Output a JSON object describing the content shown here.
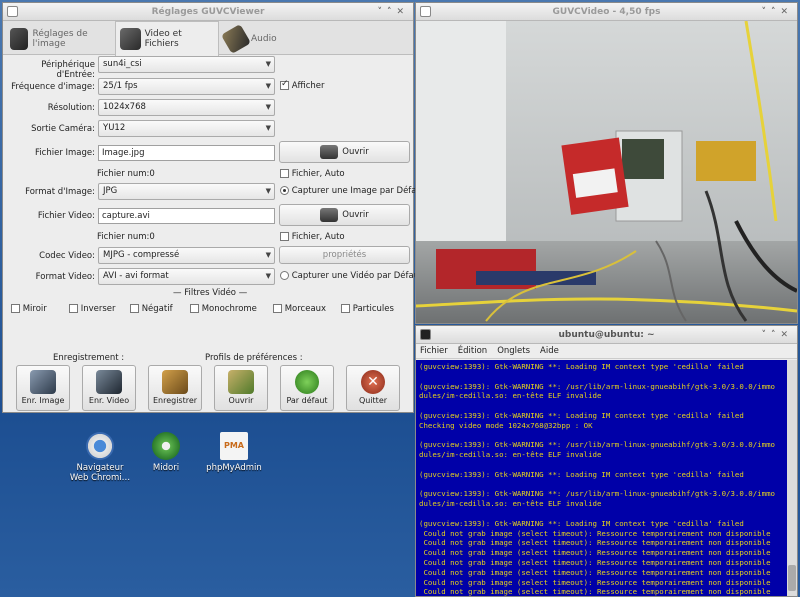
{
  "settings": {
    "title": "Réglages GUVCViewer",
    "tabs": [
      "Réglages de l'image",
      "Video et Fichiers",
      "Audio"
    ],
    "peripherique": {
      "label": "Périphérique d'Entrée:",
      "value": "sun4i_csi"
    },
    "frequence": {
      "label": "Fréquence d'image:",
      "value": "25/1 fps",
      "afficher": "Afficher"
    },
    "resolution": {
      "label": "Résolution:",
      "value": "1024x768"
    },
    "sortie": {
      "label": "Sortie Caméra:",
      "value": "YU12"
    },
    "fichier_image": {
      "label": "Fichier Image:",
      "value": "Image.jpg",
      "button": "Ouvrir",
      "num": "Fichier num:0",
      "auto": "Fichier, Auto"
    },
    "format_image": {
      "label": "Format d'Image:",
      "value": "JPG",
      "radio": "Capturer une Image par Défaut"
    },
    "fichier_video": {
      "label": "Fichier Video:",
      "value": "capture.avi",
      "button": "Ouvrir",
      "num": "Fichier num:0",
      "auto": "Fichier, Auto"
    },
    "codec": {
      "label": "Codec Video:",
      "value": "MJPG - compressé",
      "button": "propriétés"
    },
    "format_video": {
      "label": "Format Video:",
      "value": "AVI - avi format",
      "radio": "Capturer une Vidéo par Défaut"
    },
    "filtres_title": "— Filtres Vidéo —",
    "filtres": [
      "Miroir",
      "Inverser",
      "Négatif",
      "Monochrome",
      "Morceaux",
      "Particules"
    ],
    "enregistrement": "Enregistrement :",
    "profils": "Profils de préférences :",
    "buttons": [
      "Enr. Image",
      "Enr. Video",
      "Enregistrer",
      "Ouvrir",
      "Par défaut",
      "Quitter"
    ]
  },
  "video": {
    "title": "GUVCVideo - 4,50 fps"
  },
  "terminal": {
    "title": "ubuntu@ubuntu: ~",
    "menu": [
      "Fichier",
      "Édition",
      "Onglets",
      "Aide"
    ],
    "lines": [
      "(guvcview:1393): Gtk-WARNING **: Loading IM context type 'cedilla' failed",
      "",
      "(guvcview:1393): Gtk-WARNING **: /usr/lib/arm-linux-gnueabihf/gtk-3.0/3.0.0/immo",
      "dules/im-cedilla.so: en-tête ELF invalide",
      "",
      "(guvcview:1393): Gtk-WARNING **: Loading IM context type 'cedilla' failed",
      "Checking video mode 1024x768@32bpp : OK",
      "",
      "(guvcview:1393): Gtk-WARNING **: /usr/lib/arm-linux-gnueabihf/gtk-3.0/3.0.0/immo",
      "dules/im-cedilla.so: en-tête ELF invalide",
      "",
      "(guvcview:1393): Gtk-WARNING **: Loading IM context type 'cedilla' failed",
      "",
      "(guvcview:1393): Gtk-WARNING **: /usr/lib/arm-linux-gnueabihf/gtk-3.0/3.0.0/immo",
      "dules/im-cedilla.so: en-tête ELF invalide",
      "",
      "(guvcview:1393): Gtk-WARNING **: Loading IM context type 'cedilla' failed",
      " Could not grab image (select timeout): Ressource temporairement non disponible",
      " Could not grab image (select timeout): Ressource temporairement non disponible",
      " Could not grab image (select timeout): Ressource temporairement non disponible",
      " Could not grab image (select timeout): Ressource temporairement non disponible",
      " Could not grab image (select timeout): Ressource temporairement non disponible",
      " Could not grab image (select timeout): Ressource temporairement non disponible",
      " Could not grab image (select timeout): Ressource temporairement non disponible"
    ]
  },
  "desktop": {
    "icons": [
      "Navigateur Web Chromi…",
      "Midori",
      "phpMyAdmin"
    ],
    "pma_text": "PMA"
  },
  "colors": {
    "terminal_bg": "#0000a8",
    "terminal_fg": "#e6d21a"
  }
}
